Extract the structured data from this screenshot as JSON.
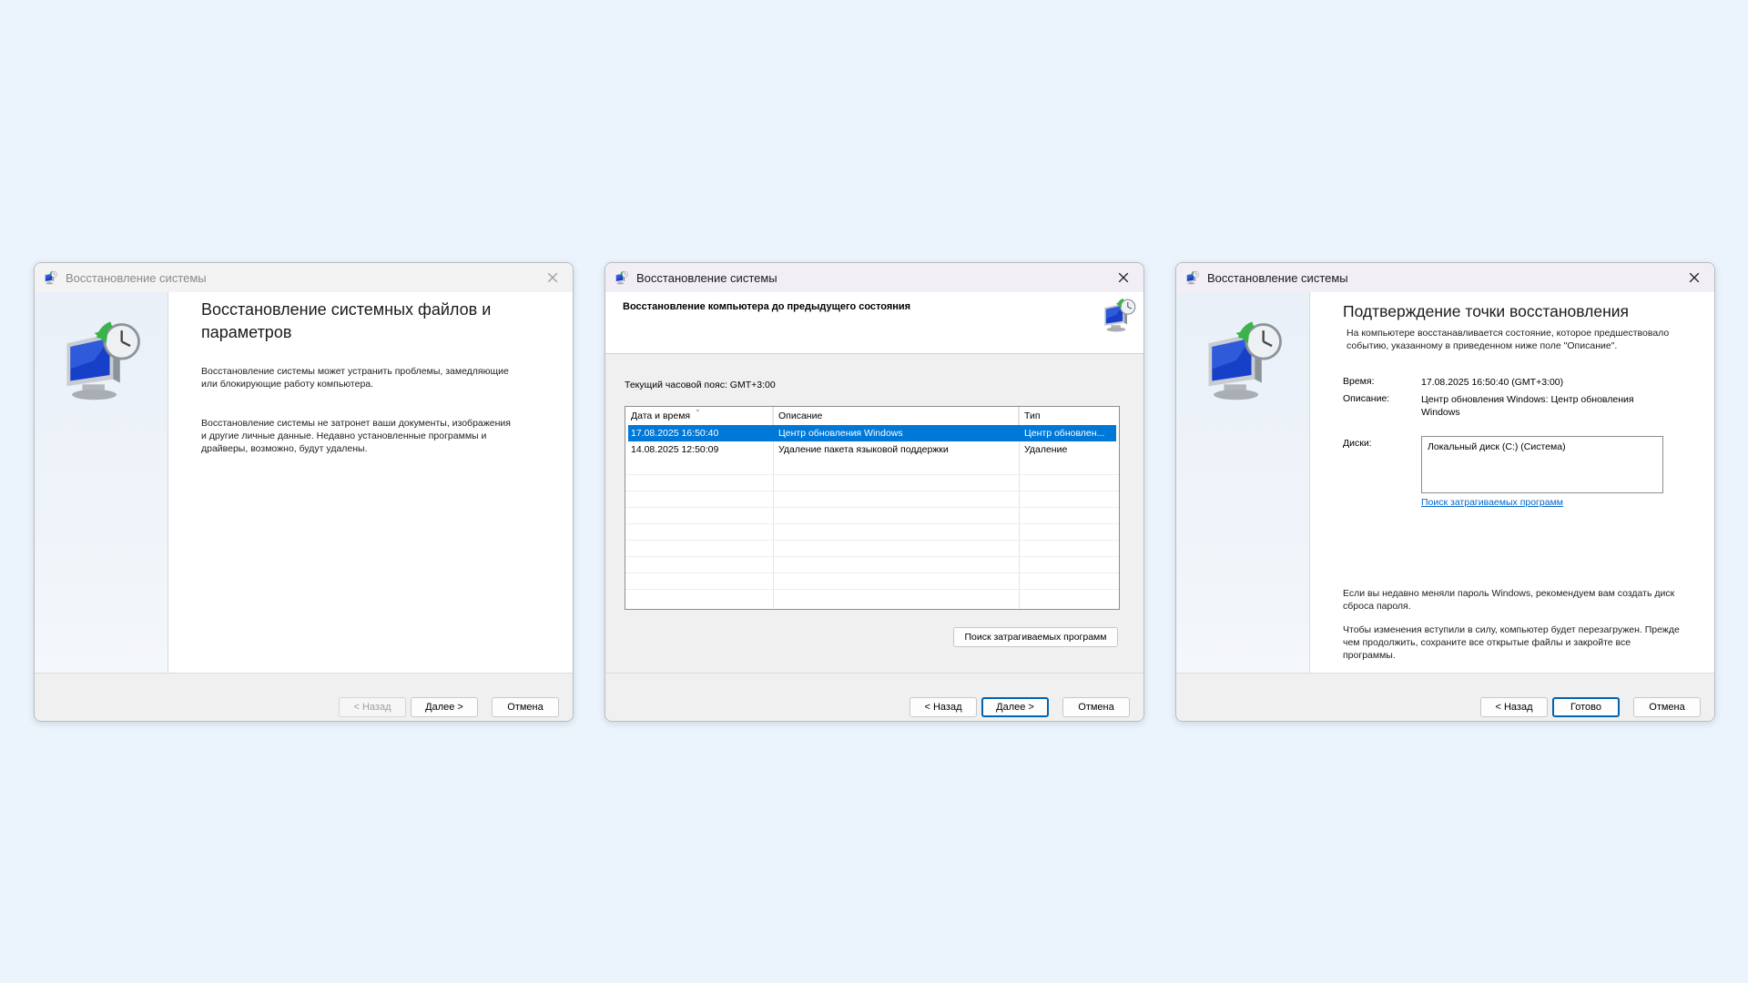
{
  "app_title": "Восстановление системы",
  "windows": [
    {
      "heading": "Восстановление системных файлов и параметров",
      "paragraphs": [
        "Восстановление системы может устранить проблемы, замедляющие или блокирующие работу компьютера.",
        "Восстановление системы не затронет ваши документы, изображения и другие личные данные. Недавно установленные программы и драйверы, возможно, будут удалены."
      ],
      "buttons": {
        "back": "< Назад",
        "next": "Далее >",
        "cancel": "Отмена"
      }
    },
    {
      "heading": "Восстановление компьютера до предыдущего состояния",
      "timezone": "Текущий часовой пояс: GMT+3:00",
      "columns": [
        "Дата и время",
        "Описание",
        "Тип"
      ],
      "rows": [
        {
          "datetime": "17.08.2025 16:50:40",
          "description": "Центр обновления Windows",
          "type": "Центр обновлен...",
          "selected": true
        },
        {
          "datetime": "14.08.2025 12:50:09",
          "description": "Удаление пакета языковой поддержки",
          "type": "Удаление",
          "selected": false
        }
      ],
      "scan_button": "Поиск затрагиваемых программ",
      "buttons": {
        "back": "< Назад",
        "next": "Далее >",
        "cancel": "Отмена"
      }
    },
    {
      "heading": "Подтверждение точки восстановления",
      "intro": "На компьютере восстанавливается состояние, которое предшествовало событию, указанному в приведенном ниже поле \"Описание\".",
      "time_label": "Время:",
      "time_value": "17.08.2025 16:50:40 (GMT+3:00)",
      "description_label": "Описание:",
      "description_value": "Центр обновления Windows: Центр обновления Windows",
      "disks_label": "Диски:",
      "disks_value": "Локальный диск (C:) (Система)",
      "scan_link": "Поиск затрагиваемых программ",
      "password_note": "Если вы недавно меняли пароль Windows, рекомендуем вам создать диск сброса пароля.",
      "restart_note": "Чтобы изменения вступили в силу, компьютер будет перезагружен. Прежде чем продолжить, сохраните все открытые файлы и закройте все программы.",
      "buttons": {
        "back": "< Назад",
        "finish": "Готово",
        "cancel": "Отмена"
      }
    }
  ],
  "icons": {
    "app": "system-restore-icon",
    "close": "close-icon"
  },
  "colors": {
    "background": "#ebf3fd",
    "selection": "#0078d7",
    "link": "#0066cc",
    "primary_border": "#0063b1"
  }
}
